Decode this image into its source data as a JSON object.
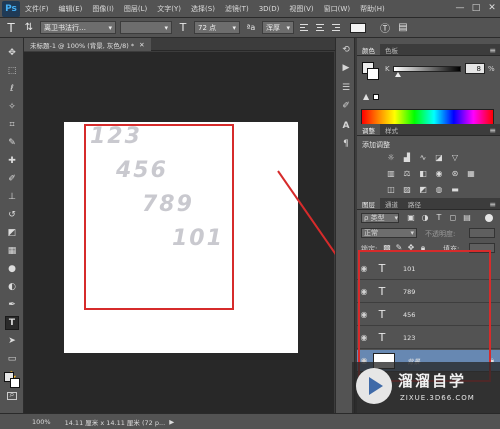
{
  "menubar": {
    "logo": "Ps",
    "items": [
      "文件(F)",
      "编辑(E)",
      "图像(I)",
      "图层(L)",
      "文字(Y)",
      "选择(S)",
      "滤镜(T)",
      "3D(D)",
      "视图(V)",
      "窗口(W)",
      "帮助(H)"
    ],
    "window_buttons": [
      "—",
      "□",
      "✕"
    ]
  },
  "options": {
    "tool_icon": "T",
    "font_family": "离卫书法行…",
    "font_size": "72 点",
    "aa_label": "浑厚"
  },
  "document": {
    "tab_label": "未标题-1 @ 100% (背景, 灰色/8) *",
    "close": "✕"
  },
  "canvas_text": [
    "123",
    "456",
    "789",
    "101"
  ],
  "color_panel": {
    "tabs": [
      "颜色",
      "色板"
    ],
    "slider_label": "K",
    "slider_value": "8",
    "slider_unit": "%"
  },
  "adjust_panel": {
    "tabs": [
      "调整",
      "样式"
    ],
    "title": "添加调整"
  },
  "layers_panel": {
    "tabs": [
      "图层",
      "通道",
      "路径"
    ],
    "kind_label": "ρ 类型",
    "blend_mode": "正常",
    "opacity_label": "不透明度:",
    "lock_label": "锁定:",
    "fill_label": "填充:",
    "layers": [
      {
        "name": "101",
        "type": "text"
      },
      {
        "name": "789",
        "type": "text"
      },
      {
        "name": "456",
        "type": "text"
      },
      {
        "name": "123",
        "type": "text"
      },
      {
        "name": "背景",
        "type": "background"
      }
    ]
  },
  "status": {
    "zoom": "100%",
    "doc_info": "14.11 厘米 x 14.11 厘米 (72 p..."
  },
  "watermark": {
    "name": "溜溜自学",
    "url": "ZIXUE.3D66.COM"
  }
}
